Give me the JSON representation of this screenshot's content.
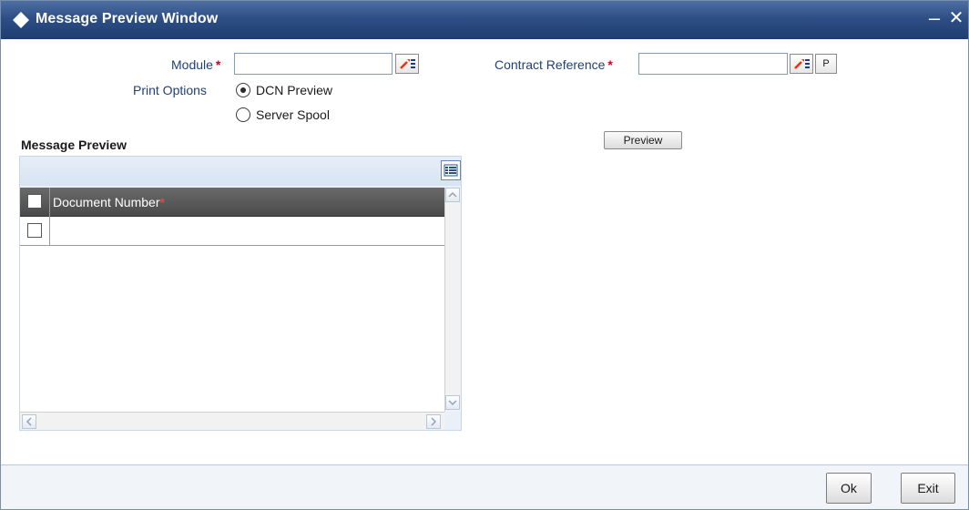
{
  "window": {
    "title": "Message Preview Window",
    "minimize_glyph": "–",
    "close_glyph": "✕"
  },
  "form": {
    "module_label": "Module",
    "module_value": "",
    "contract_reference_label": "Contract Reference",
    "contract_reference_value": "",
    "required_mark": "*",
    "p_button_label": "P",
    "print_options_label": "Print Options",
    "print_options": [
      {
        "label": "DCN Preview",
        "selected": true
      },
      {
        "label": "Server Spool",
        "selected": false
      }
    ],
    "preview_button_label": "Preview"
  },
  "message_preview": {
    "title": "Message Preview",
    "columns": [
      {
        "label": "Document Number",
        "required": true
      }
    ],
    "rows": [
      {
        "document_number": ""
      }
    ]
  },
  "footer": {
    "ok_label": "Ok",
    "exit_label": "Exit"
  },
  "colors": {
    "titlebar": "#2d4f86",
    "label": "#1f3f7a",
    "required": "#d0021b",
    "grid_header": "#5a5a5a"
  }
}
